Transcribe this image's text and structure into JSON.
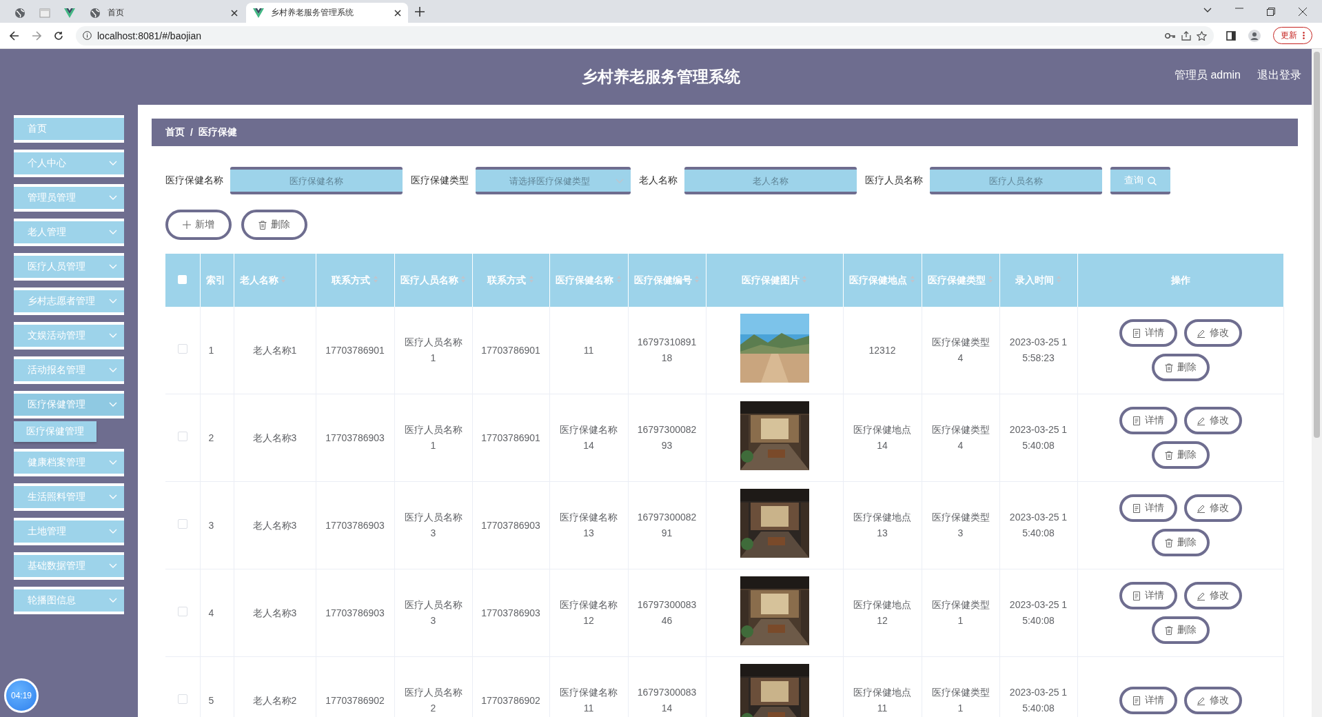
{
  "browser": {
    "tabs": [
      {
        "selected": false
      },
      {
        "selected": false
      },
      {
        "selected": false
      },
      {
        "title": "首页",
        "selected": false
      },
      {
        "title": "乡村养老服务管理系统",
        "selected": true
      }
    ],
    "url": "localhost:8081/#/baojian",
    "update_button": "更新"
  },
  "header": {
    "title": "乡村养老服务管理系统",
    "user": "管理员 admin",
    "logout": "退出登录"
  },
  "sidebar": {
    "items": [
      {
        "kind": "link",
        "label": "首页"
      },
      {
        "kind": "menu",
        "label": "个人中心",
        "expanded": false
      },
      {
        "kind": "menu",
        "label": "管理员管理",
        "expanded": false
      },
      {
        "kind": "menu",
        "label": "老人管理",
        "expanded": false
      },
      {
        "kind": "menu",
        "label": "医疗人员管理",
        "expanded": false
      },
      {
        "kind": "menu",
        "label": "乡村志愿者管理",
        "expanded": false
      },
      {
        "kind": "menu",
        "label": "文娱活动管理",
        "expanded": false
      },
      {
        "kind": "menu",
        "label": "活动报名管理",
        "expanded": false
      },
      {
        "kind": "menu",
        "label": "医疗保健管理",
        "expanded": true,
        "children": [
          {
            "label": "医疗保健管理"
          }
        ]
      },
      {
        "kind": "menu",
        "label": "健康档案管理",
        "expanded": false
      },
      {
        "kind": "menu",
        "label": "生活照料管理",
        "expanded": false
      },
      {
        "kind": "menu",
        "label": "土地管理",
        "expanded": false
      },
      {
        "kind": "menu",
        "label": "基础数据管理",
        "expanded": false
      },
      {
        "kind": "menu",
        "label": "轮播图信息",
        "expanded": false
      }
    ]
  },
  "breadcrumb": [
    "首页",
    "/",
    "医疗保健"
  ],
  "search": {
    "fields": [
      {
        "kind": "text",
        "label": "医疗保健名称",
        "placeholder": "医疗保健名称"
      },
      {
        "kind": "select",
        "label": "医疗保健类型",
        "placeholder": "请选择医疗保健类型"
      },
      {
        "kind": "text",
        "label": "老人名称",
        "placeholder": "老人名称"
      },
      {
        "kind": "text",
        "label": "医疗人员名称",
        "placeholder": "医疗人员名称"
      }
    ],
    "button": "查询"
  },
  "actions": [
    "新增",
    "删除"
  ],
  "table": {
    "header_checked": false,
    "columns": [
      {
        "label": "索引",
        "sortable": false
      },
      {
        "label": "老人名称",
        "sortable": true
      },
      {
        "label": "联系方式",
        "sortable": true
      },
      {
        "label": "医疗人员名称",
        "sortable": true
      },
      {
        "label": "联系方式",
        "sortable": true
      },
      {
        "label": "医疗保健名称",
        "sortable": true
      },
      {
        "label": "医疗保健编号",
        "sortable": true
      },
      {
        "label": "医疗保健图片",
        "sortable": true
      },
      {
        "label": "医疗保健地点",
        "sortable": true
      },
      {
        "label": "医疗保健类型",
        "sortable": true
      },
      {
        "label": "录入时间",
        "sortable": true
      },
      {
        "label": "操作",
        "sortable": false
      }
    ],
    "rows": [
      {
        "checked": false,
        "cells": [
          "1",
          "老人名称1",
          "17703786901",
          "医疗人员名称1",
          "17703786901",
          "11",
          "1679731089118",
          {
            "kind": "picture"
          },
          "12312",
          "医疗保健类型4",
          "2023-03-25 15:58:23"
        ],
        "buttons": [
          "详情",
          "修改",
          "删除"
        ]
      },
      {
        "checked": false,
        "cells": [
          "2",
          "老人名称3",
          "17703786903",
          "医疗人员名称1",
          "17703786901",
          "医疗保健名称14",
          "1679730008293",
          {
            "kind": "picture"
          },
          "医疗保健地点14",
          "医疗保健类型4",
          "2023-03-25 15:40:08"
        ],
        "buttons": [
          "详情",
          "修改",
          "删除"
        ]
      },
      {
        "checked": false,
        "cells": [
          "3",
          "老人名称3",
          "17703786903",
          "医疗人员名称3",
          "17703786903",
          "医疗保健名称13",
          "1679730008291",
          {
            "kind": "picture"
          },
          "医疗保健地点13",
          "医疗保健类型3",
          "2023-03-25 15:40:08"
        ],
        "buttons": [
          "详情",
          "修改",
          "删除"
        ]
      },
      {
        "checked": false,
        "cells": [
          "4",
          "老人名称3",
          "17703786903",
          "医疗人员名称3",
          "17703786903",
          "医疗保健名称12",
          "1679730008346",
          {
            "kind": "picture"
          },
          "医疗保健地点12",
          "医疗保健类型1",
          "2023-03-25 15:40:08"
        ],
        "buttons": [
          "详情",
          "修改",
          "删除"
        ]
      },
      {
        "checked": false,
        "cells": [
          "5",
          "老人名称2",
          "17703786902",
          "医疗人员名称2",
          "17703786902",
          "医疗保健名称11",
          "1679730008314",
          {
            "kind": "picture"
          },
          "医疗保健地点11",
          "医疗保健类型1",
          "2023-03-25 15:40:08"
        ],
        "buttons": [
          "详情",
          "修改"
        ]
      }
    ]
  },
  "timer": "04:19"
}
